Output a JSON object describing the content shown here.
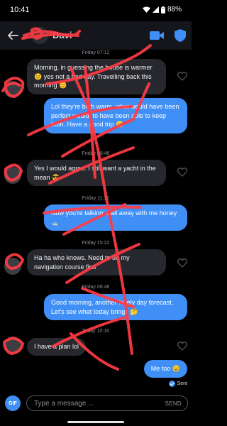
{
  "status_bar": {
    "time": "10:41",
    "battery": "88%"
  },
  "header": {
    "contact_name": "Davi"
  },
  "messages": [
    {
      "timestamp": "Friday 07:12"
    },
    {
      "text": "Morning, in guessing the house is warmer 😊 yes not a bad day. Travelling back this morning 😊"
    },
    {
      "text": "Lol they're both warm. what would have been perfect would, to have been able to keep both. Have a good trip 😁"
    },
    {
      "timestamp": "Friday 08:46"
    },
    {
      "text": "Yes I would agree. I still want a yacht in the mean 😎"
    },
    {
      "timestamp": "Friday 11:32"
    },
    {
      "text": "Now you're talking.  Sail away with me honey 🛥️"
    },
    {
      "timestamp": "Friday 15:22"
    },
    {
      "text": "Ha ha who knows. Need to do my navigation course first"
    },
    {
      "timestamp": "Friday 08:46"
    },
    {
      "text": "Good morning, another lovely day forecast. Let's see what today brings 🤔"
    },
    {
      "timestamp": "Today 10:16"
    },
    {
      "text": "I have a plan lol"
    },
    {
      "text": "Me too 😉"
    }
  ],
  "sent_status": "Sent",
  "composer": {
    "gif_label": "GIF",
    "placeholder": "Type a message ...",
    "send_label": "SEND"
  },
  "colors": {
    "accent_blue": "#3f8ff7",
    "incoming_bubble": "#27282e",
    "scribble_red": "#ff3b45"
  }
}
